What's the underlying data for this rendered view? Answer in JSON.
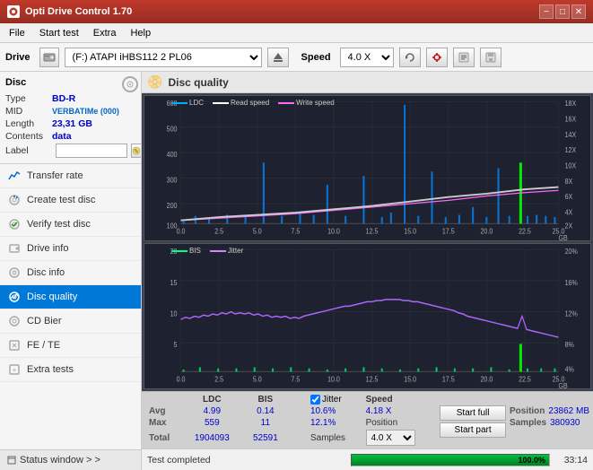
{
  "titlebar": {
    "title": "Opti Drive Control 1.70",
    "minimize": "−",
    "maximize": "□",
    "close": "✕"
  },
  "menubar": {
    "items": [
      "File",
      "Start test",
      "Extra",
      "Help"
    ]
  },
  "toolbar": {
    "drive_label": "Drive",
    "drive_value": "(F:)  ATAPI iHBS112  2 PL06",
    "speed_label": "Speed",
    "speed_value": "4.0 X"
  },
  "disc": {
    "title": "Disc",
    "type_label": "Type",
    "type_value": "BD-R",
    "mid_label": "MID",
    "mid_value": "VERBATIMe (000)",
    "length_label": "Length",
    "length_value": "23,31 GB",
    "contents_label": "Contents",
    "contents_value": "data",
    "label_label": "Label",
    "label_placeholder": ""
  },
  "nav": {
    "items": [
      {
        "id": "transfer-rate",
        "label": "Transfer rate",
        "active": false
      },
      {
        "id": "create-test-disc",
        "label": "Create test disc",
        "active": false
      },
      {
        "id": "verify-test-disc",
        "label": "Verify test disc",
        "active": false
      },
      {
        "id": "drive-info",
        "label": "Drive info",
        "active": false
      },
      {
        "id": "disc-info",
        "label": "Disc info",
        "active": false
      },
      {
        "id": "disc-quality",
        "label": "Disc quality",
        "active": true
      },
      {
        "id": "cd-bier",
        "label": "CD Bier",
        "active": false
      },
      {
        "id": "fe-te",
        "label": "FE / TE",
        "active": false
      },
      {
        "id": "extra-tests",
        "label": "Extra tests",
        "active": false
      }
    ],
    "status_window": "Status window  > >"
  },
  "disc_quality": {
    "title": "Disc quality",
    "legend": {
      "ldc_label": "LDC",
      "read_speed_label": "Read speed",
      "write_speed_label": "Write speed",
      "bis_label": "BIS",
      "jitter_label": "Jitter"
    },
    "chart1": {
      "y_max": 600,
      "y_labels": [
        "600",
        "500",
        "400",
        "300",
        "200",
        "100"
      ],
      "x_labels": [
        "0.0",
        "2.5",
        "5.0",
        "7.5",
        "10.0",
        "12.5",
        "15.0",
        "17.5",
        "20.0",
        "22.5",
        "25.0"
      ],
      "right_labels": [
        "18X",
        "16X",
        "14X",
        "12X",
        "10X",
        "8X",
        "6X",
        "4X",
        "2X"
      ]
    },
    "chart2": {
      "y_max": 20,
      "y_labels": [
        "20",
        "15",
        "10",
        "5"
      ],
      "x_labels": [
        "0.0",
        "2.5",
        "5.0",
        "7.5",
        "10.0",
        "12.5",
        "15.0",
        "17.5",
        "20.0",
        "22.5",
        "25.0"
      ],
      "right_labels": [
        "20%",
        "16%",
        "12%",
        "8%",
        "4%"
      ]
    }
  },
  "stats": {
    "headers": [
      "",
      "LDC",
      "BIS",
      "",
      "Jitter",
      "Speed",
      ""
    ],
    "avg_label": "Avg",
    "avg_ldc": "4.99",
    "avg_bis": "0.14",
    "avg_jitter": "10.6%",
    "avg_speed": "4.18 X",
    "max_label": "Max",
    "max_ldc": "559",
    "max_bis": "11",
    "max_jitter": "12.1%",
    "position_label": "Position",
    "position_value": "23862 MB",
    "total_label": "Total",
    "total_ldc": "1904093",
    "total_bis": "52591",
    "samples_label": "Samples",
    "samples_value": "380930",
    "jitter_checked": true,
    "jitter_check_label": "Jitter",
    "speed_select_value": "4.0 X",
    "start_full_label": "Start full",
    "start_part_label": "Start part"
  },
  "progress": {
    "status_text": "Test completed",
    "progress_percent": 100,
    "progress_display": "100.0%",
    "time_text": "33:14"
  }
}
